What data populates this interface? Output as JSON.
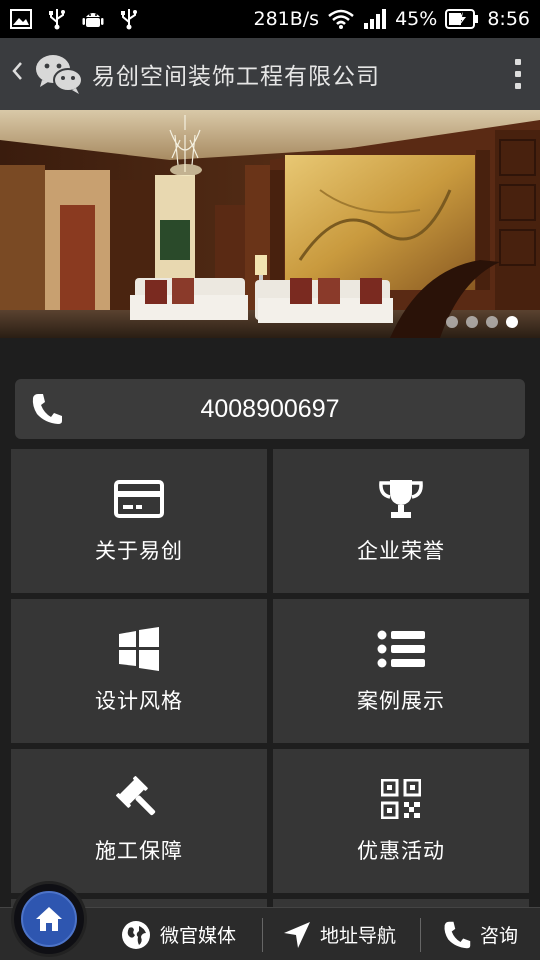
{
  "status_bar": {
    "network_speed": "281B/s",
    "battery": "45%",
    "time": "8:56",
    "left_icons": [
      "gallery-icon",
      "usb-icon",
      "android-icon",
      "usb-icon"
    ]
  },
  "header": {
    "title": "易创空间装饰工程有限公司"
  },
  "banner": {
    "slide_count": 4,
    "active_slide": 4
  },
  "phone": {
    "number": "4008900697"
  },
  "tiles": [
    {
      "label": "关于易创",
      "icon": "id-card-icon"
    },
    {
      "label": "企业荣誉",
      "icon": "trophy-icon"
    },
    {
      "label": "设计风格",
      "icon": "windows-icon"
    },
    {
      "label": "案例展示",
      "icon": "list-icon"
    },
    {
      "label": "施工保障",
      "icon": "gavel-icon"
    },
    {
      "label": "优惠活动",
      "icon": "qr-code-icon"
    }
  ],
  "bottom_nav": {
    "home_icon": "home-icon",
    "items": [
      {
        "label": "微官媒体",
        "icon": "globe-icon"
      },
      {
        "label": "地址导航",
        "icon": "navigation-arrow-icon"
      },
      {
        "label": "咨询",
        "icon": "phone-icon"
      }
    ]
  },
  "colors": {
    "header_bg": "#3a3c3f",
    "tile_bg": "#363636",
    "content_bg": "#1e1e1e",
    "home_button": "#2e56b0"
  }
}
